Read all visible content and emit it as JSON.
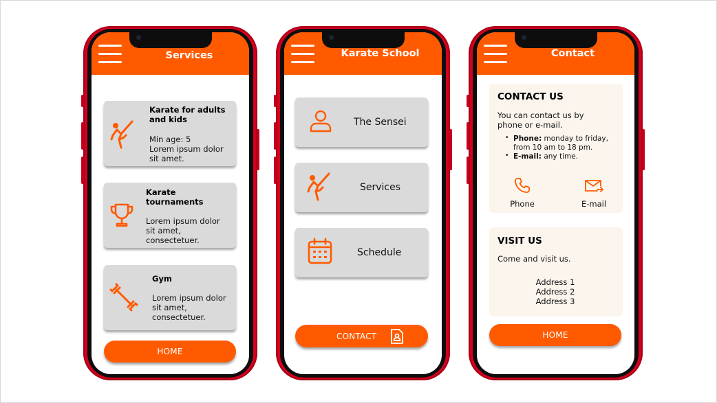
{
  "colors": {
    "accent": "#ff5a00",
    "phone_frame": "#d4001f",
    "card": "#dadada",
    "panel": "#fcf5ee"
  },
  "services_screen": {
    "title": "Services",
    "cards": [
      {
        "icon": "karate-kick-icon",
        "title": "Karate for adults and kids",
        "body": "Min age: 5\nLorem ipsum dolor sit amet."
      },
      {
        "icon": "trophy-icon",
        "title": "Karate tournaments",
        "body": "Lorem ipsum dolor sit amet, consectetuer."
      },
      {
        "icon": "dumbbell-icon",
        "title": "Gym",
        "body": "Lorem ipsum dolor sit amet, consectetuer."
      }
    ],
    "home_label": "HOME"
  },
  "home_screen": {
    "title": "Karate School",
    "menu": [
      {
        "icon": "person-icon",
        "label": "The Sensei"
      },
      {
        "icon": "karate-kick-icon",
        "label": "Services"
      },
      {
        "icon": "calendar-icon",
        "label": "Schedule"
      }
    ],
    "contact_label": "CONTACT",
    "contact_icon": "contact-card-icon"
  },
  "contact_screen": {
    "title": "Contact",
    "contact_us": {
      "heading": "CONTACT US",
      "intro": "You can contact us by phone or e-mail.",
      "phone_label": "Phone:",
      "phone_text": "monday to friday, from 10 am to 18 pm.",
      "email_label": "E-mail:",
      "email_text": "any time.",
      "phone_button": "Phone",
      "email_button": "E-mail"
    },
    "visit_us": {
      "heading": "VISIT US",
      "intro": "Come and visit us.",
      "addresses": [
        "Address 1",
        "Address 2",
        "Address 3"
      ]
    },
    "home_label": "HOME"
  }
}
